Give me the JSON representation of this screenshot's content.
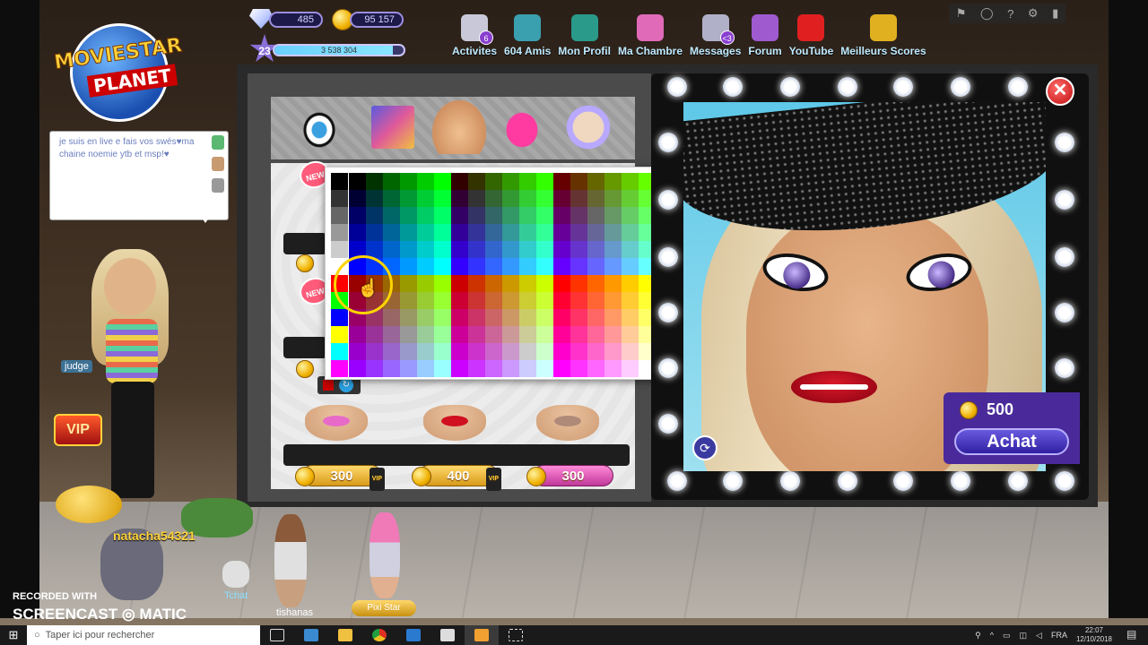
{
  "hud": {
    "diamonds": "485",
    "coins": "95 157",
    "level": "23",
    "fame": "3 538 304",
    "fame_progress": 0.92
  },
  "nav": [
    {
      "label": "Activites",
      "icon": "activities-icon",
      "badge": "6",
      "color": "#c8c8d8"
    },
    {
      "label": "604 Amis",
      "icon": "friends-icon",
      "badge": "",
      "color": "#3aa0b0"
    },
    {
      "label": "Mon Profil",
      "icon": "profile-icon",
      "badge": "",
      "color": "#2a9a8a"
    },
    {
      "label": "Ma Chambre",
      "icon": "room-icon",
      "badge": "",
      "color": "#e06ab8"
    },
    {
      "label": "Messages",
      "icon": "messages-icon",
      "badge": "<3",
      "color": "#b0b0c8"
    },
    {
      "label": "Forum",
      "icon": "forum-icon",
      "badge": "",
      "color": "#a05ad0"
    },
    {
      "label": "YouTube",
      "icon": "youtube-icon",
      "badge": "",
      "color": "#e02020"
    },
    {
      "label": "Meilleurs Scores",
      "icon": "trophy-icon",
      "badge": "",
      "color": "#e0b020"
    }
  ],
  "logo": {
    "line1": "MOVIESTAR",
    "line2": "PLANET"
  },
  "chat": {
    "text": "je suis en live e fais vos swés♥ma chaine noemie ytb et msp!♥"
  },
  "editor": {
    "categories": [
      "eyes-icon",
      "eyeshadow-palette-icon",
      "nose-icon",
      "lips-icon",
      "foundation-icon"
    ],
    "new_label": "NEW",
    "prices": [
      {
        "value": "300",
        "vip": true,
        "style": "gold"
      },
      {
        "value": "400",
        "vip": true,
        "style": "gold"
      },
      {
        "value": "300",
        "vip": false,
        "style": "pink"
      }
    ],
    "vip_small": "VIP",
    "lip_colors": [
      "#e86ac8",
      "#d01020",
      "#b08a78"
    ]
  },
  "purchase": {
    "price": "500",
    "button": "Achat",
    "close": "✕"
  },
  "room": {
    "player_name": "judge",
    "vip": "VIP",
    "others": [
      {
        "name": "natacha54321"
      },
      {
        "name": "tishanas"
      },
      {
        "name": "Tchat"
      },
      {
        "name": "Pixi Star"
      }
    ]
  },
  "watermark": {
    "line1": "RECORDED WITH",
    "line2": "SCREENCAST  ◎ MATIC"
  },
  "taskbar": {
    "search_placeholder": "Taper ici pour rechercher",
    "lang": "FRA",
    "time": "22:07",
    "date": "12/10/2018"
  },
  "palette": {
    "block_colors": [
      [
        "#000000",
        "#00ff00",
        "#0000ff"
      ],
      [
        "#ff00ff",
        "#ff0000",
        "#ffff00"
      ]
    ]
  }
}
